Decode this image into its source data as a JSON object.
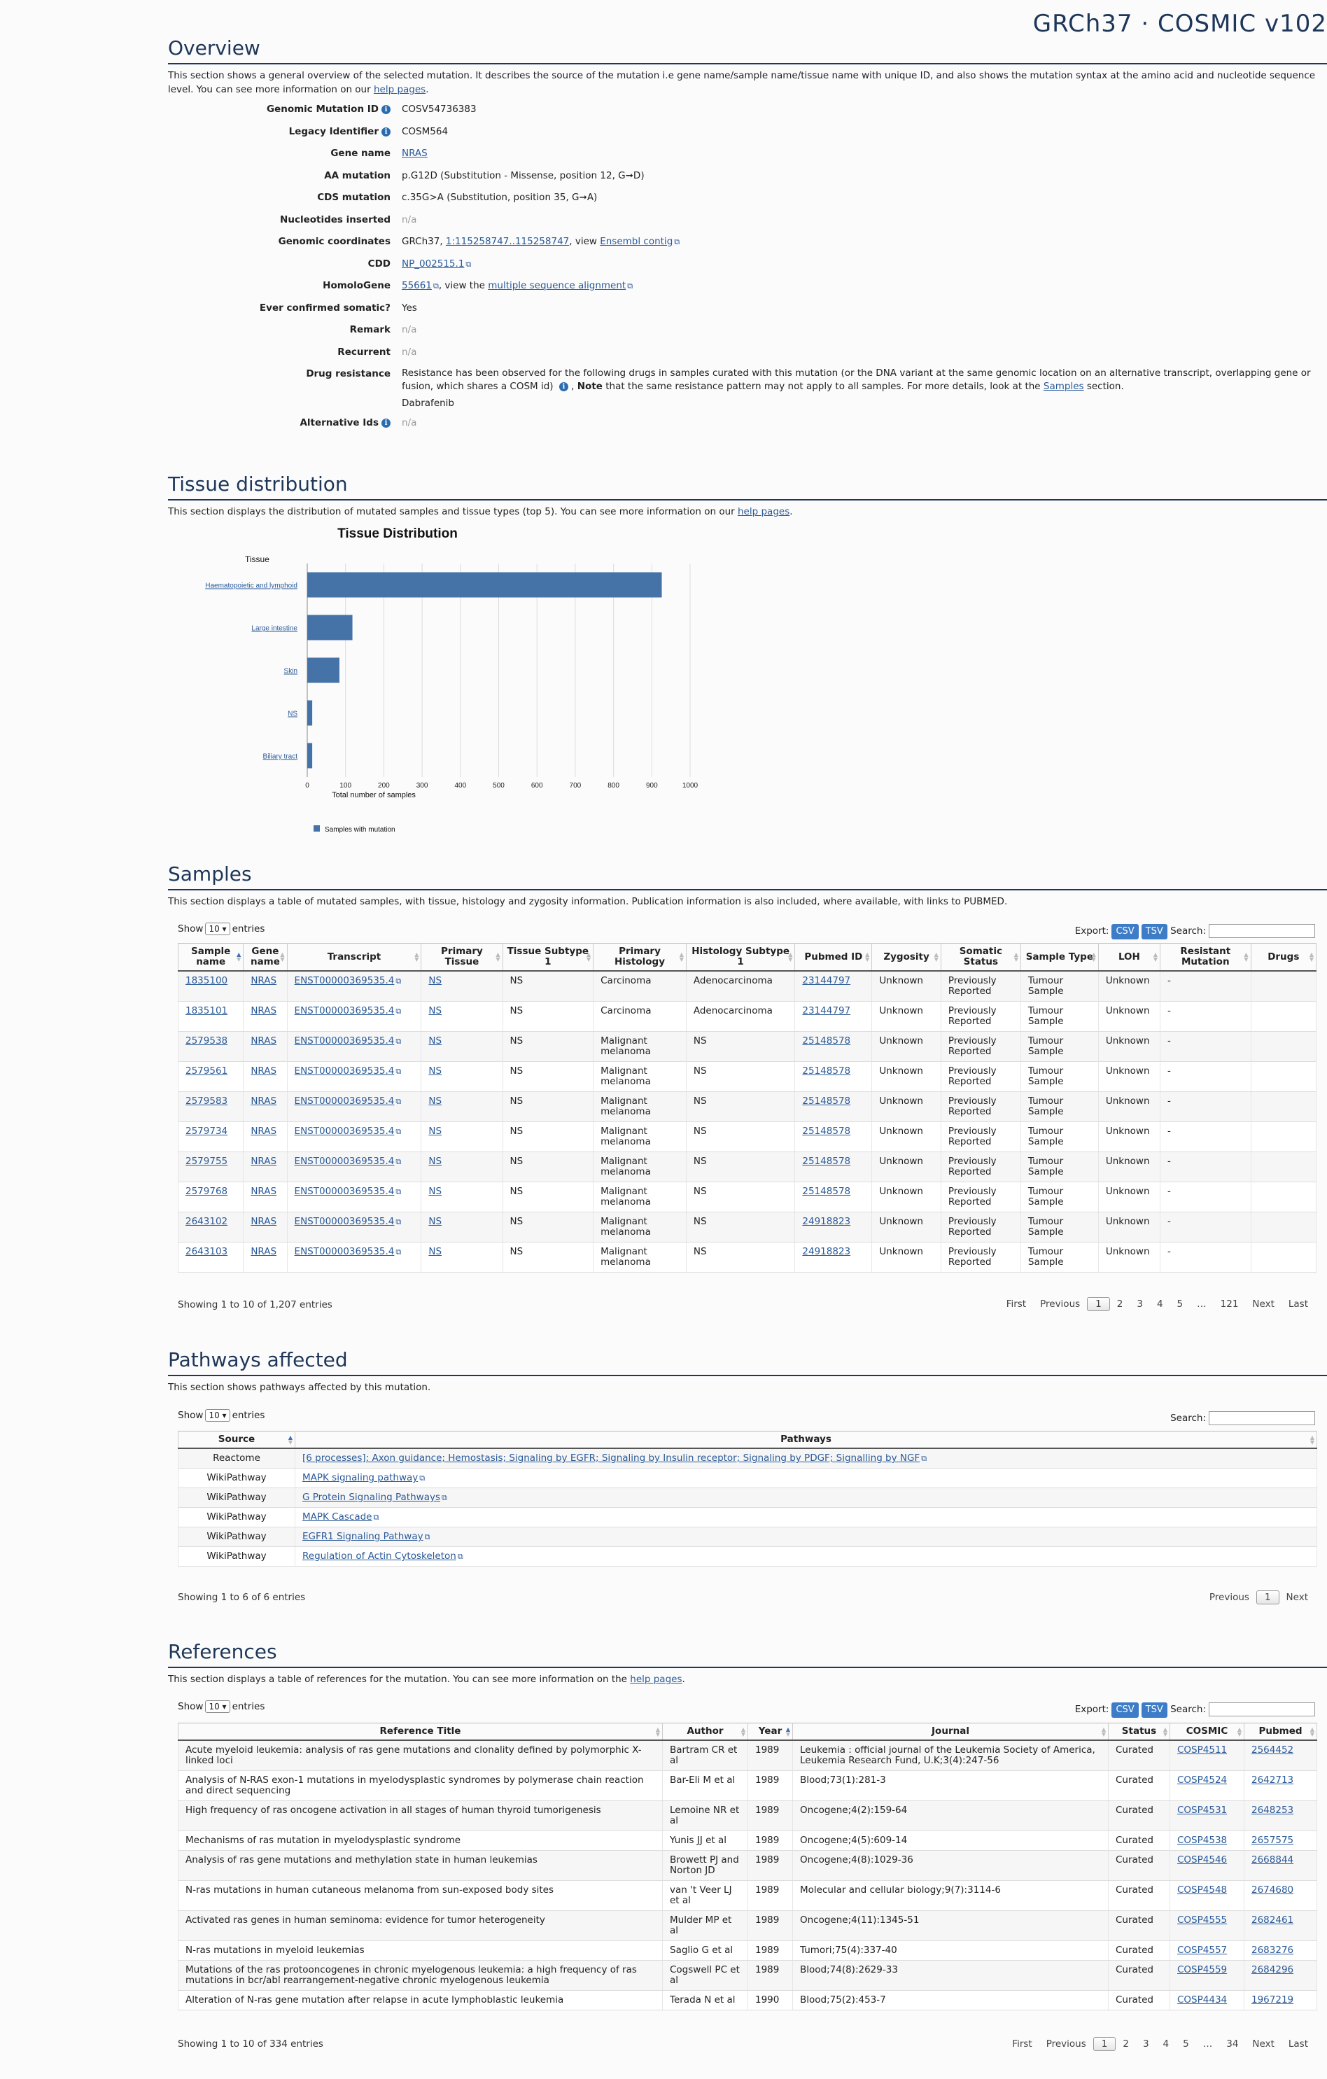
{
  "brand": "GRCh37 · COSMIC v102",
  "overview": {
    "title": "Overview",
    "desc_before": "This section shows a general overview of the selected mutation. It describes the source of the mutation i.e gene name/sample name/tissue name with unique ID, and also shows the mutation syntax at the amino acid and nucleotide sequence level. You can see more information on our ",
    "help_link": "help pages",
    "desc_after": ".",
    "rows": {
      "genomic_mutation_id": {
        "label": "Genomic Mutation ID",
        "value": "COSV54736383"
      },
      "legacy_identifier": {
        "label": "Legacy Identifier",
        "value": "COSM564"
      },
      "gene_name": {
        "label": "Gene name",
        "value": "NRAS"
      },
      "aa_mutation": {
        "label": "AA mutation",
        "value": "p.G12D (Substitution - Missense, position 12, G➞D)"
      },
      "cds_mutation": {
        "label": "CDS mutation",
        "value": "c.35G>A (Substitution, position 35, G➞A)"
      },
      "nucleotides_inserted": {
        "label": "Nucleotides inserted",
        "value": "n/a"
      },
      "genomic_coordinates": {
        "label": "Genomic coordinates",
        "prefix": "GRCh37, ",
        "link": "1:115258747..115258747",
        "mid": ", view ",
        "link2": "Ensembl contig"
      },
      "cdd": {
        "label": "CDD",
        "link": "NP_002515.1"
      },
      "homologene": {
        "label": "HomoloGene",
        "link": "55661",
        "mid": ", view the ",
        "link2": "multiple sequence alignment"
      },
      "ever_confirmed": {
        "label": "Ever confirmed somatic?",
        "value": "Yes"
      },
      "remark": {
        "label": "Remark",
        "value": "n/a"
      },
      "recurrent": {
        "label": "Recurrent",
        "value": "n/a"
      },
      "drug_resistance": {
        "label": "Drug resistance",
        "text1": "Resistance has been observed for the following drugs in samples curated with this mutation (or the DNA variant at the same genomic location on an alternative transcript, overlapping gene or fusion, which shares a COSM id)",
        "note_label": "Note",
        "text2": " that the same resistance pattern may not apply to all samples. For more details, look at the ",
        "samples_link": "Samples",
        "text3": " section.",
        "drug": "Dabrafenib"
      },
      "alternative_ids": {
        "label": "Alternative Ids",
        "value": "n/a"
      }
    }
  },
  "tissue": {
    "title": "Tissue distribution",
    "desc_before": "This section displays the distribution of mutated samples and tissue types (top 5). You can see more information on our ",
    "help_link": "help pages",
    "desc_after": "."
  },
  "chart_data": {
    "type": "bar",
    "orientation": "horizontal",
    "title": "Tissue Distribution",
    "ylabel": "Tissue",
    "xlabel": "Total number of samples",
    "categories": [
      "Haematopoietic and lymphoid",
      "Large intestine",
      "Skin",
      "NS",
      "Biliary tract"
    ],
    "series": [
      {
        "name": "Samples with mutation",
        "values": [
          926,
          118,
          84,
          13,
          13
        ],
        "color": "#4572a7"
      }
    ],
    "xlim": [
      0,
      1000
    ],
    "xticks": [
      0,
      100,
      200,
      300,
      400,
      500,
      600,
      700,
      800,
      900,
      1000
    ],
    "grid": true,
    "legend": "bottom-left"
  },
  "samples": {
    "title": "Samples",
    "desc": "This section displays a table of mutated samples, with tissue, histology and zygosity information. Publication information is also included, where available, with links to PUBMED.",
    "show": "Show",
    "page_size": "10",
    "entries": "entries",
    "export": "Export:",
    "csv": "CSV",
    "tsv": "TSV",
    "search": "Search:",
    "columns": [
      "Sample name",
      "Gene name",
      "Transcript",
      "Primary Tissue",
      "Tissue Subtype 1",
      "Primary Histology",
      "Histology Subtype 1",
      "Pubmed ID",
      "Zygosity",
      "Somatic Status",
      "Sample Type",
      "LOH",
      "Resistant Mutation",
      "Drugs"
    ],
    "rows": [
      [
        "1835100",
        "NRAS",
        "ENST00000369535.4",
        "NS",
        "NS",
        "Carcinoma",
        "Adenocarcinoma",
        "23144797",
        "Unknown",
        "Previously Reported",
        "Tumour Sample",
        "Unknown",
        "-",
        ""
      ],
      [
        "1835101",
        "NRAS",
        "ENST00000369535.4",
        "NS",
        "NS",
        "Carcinoma",
        "Adenocarcinoma",
        "23144797",
        "Unknown",
        "Previously Reported",
        "Tumour Sample",
        "Unknown",
        "-",
        ""
      ],
      [
        "2579538",
        "NRAS",
        "ENST00000369535.4",
        "NS",
        "NS",
        "Malignant melanoma",
        "NS",
        "25148578",
        "Unknown",
        "Previously Reported",
        "Tumour Sample",
        "Unknown",
        "-",
        ""
      ],
      [
        "2579561",
        "NRAS",
        "ENST00000369535.4",
        "NS",
        "NS",
        "Malignant melanoma",
        "NS",
        "25148578",
        "Unknown",
        "Previously Reported",
        "Tumour Sample",
        "Unknown",
        "-",
        ""
      ],
      [
        "2579583",
        "NRAS",
        "ENST00000369535.4",
        "NS",
        "NS",
        "Malignant melanoma",
        "NS",
        "25148578",
        "Unknown",
        "Previously Reported",
        "Tumour Sample",
        "Unknown",
        "-",
        ""
      ],
      [
        "2579734",
        "NRAS",
        "ENST00000369535.4",
        "NS",
        "NS",
        "Malignant melanoma",
        "NS",
        "25148578",
        "Unknown",
        "Previously Reported",
        "Tumour Sample",
        "Unknown",
        "-",
        ""
      ],
      [
        "2579755",
        "NRAS",
        "ENST00000369535.4",
        "NS",
        "NS",
        "Malignant melanoma",
        "NS",
        "25148578",
        "Unknown",
        "Previously Reported",
        "Tumour Sample",
        "Unknown",
        "-",
        ""
      ],
      [
        "2579768",
        "NRAS",
        "ENST00000369535.4",
        "NS",
        "NS",
        "Malignant melanoma",
        "NS",
        "25148578",
        "Unknown",
        "Previously Reported",
        "Tumour Sample",
        "Unknown",
        "-",
        ""
      ],
      [
        "2643102",
        "NRAS",
        "ENST00000369535.4",
        "NS",
        "NS",
        "Malignant melanoma",
        "NS",
        "24918823",
        "Unknown",
        "Previously Reported",
        "Tumour Sample",
        "Unknown",
        "-",
        ""
      ],
      [
        "2643103",
        "NRAS",
        "ENST00000369535.4",
        "NS",
        "NS",
        "Malignant melanoma",
        "NS",
        "24918823",
        "Unknown",
        "Previously Reported",
        "Tumour Sample",
        "Unknown",
        "-",
        ""
      ]
    ],
    "showing": "Showing 1 to 10 of 1,207 entries",
    "pager": [
      "First",
      "Previous",
      "1",
      "2",
      "3",
      "4",
      "5",
      "…",
      "121",
      "Next",
      "Last"
    ]
  },
  "pathways": {
    "title": "Pathways affected",
    "desc": "This section shows pathways affected by this mutation.",
    "show": "Show",
    "page_size": "10",
    "entries": "entries",
    "search": "Search:",
    "columns": [
      "Source",
      "Pathways"
    ],
    "rows": [
      [
        "Reactome",
        "[6 processes]: Axon guidance; Hemostasis; Signaling by EGFR; Signaling by Insulin receptor; Signaling by PDGF; Signalling by NGF"
      ],
      [
        "WikiPathway",
        "MAPK signaling pathway"
      ],
      [
        "WikiPathway",
        "G Protein Signaling Pathways"
      ],
      [
        "WikiPathway",
        "MAPK Cascade"
      ],
      [
        "WikiPathway",
        "EGFR1 Signaling Pathway"
      ],
      [
        "WikiPathway",
        "Regulation of Actin Cytoskeleton"
      ]
    ],
    "showing": "Showing 1 to 6 of 6 entries",
    "pager": [
      "Previous",
      "1",
      "Next"
    ]
  },
  "references": {
    "title": "References",
    "desc_before": "This section displays a table of references for the mutation. You can see more information on the ",
    "help_link": "help pages",
    "desc_after": ".",
    "show": "Show",
    "page_size": "10",
    "entries": "entries",
    "export": "Export:",
    "csv": "CSV",
    "tsv": "TSV",
    "search": "Search:",
    "columns": [
      "Reference Title",
      "Author",
      "Year",
      "Journal",
      "Status",
      "COSMIC",
      "Pubmed"
    ],
    "rows": [
      [
        "Acute myeloid leukemia: analysis of ras gene mutations and clonality defined by polymorphic X-linked loci",
        "Bartram CR et al",
        "1989",
        "Leukemia : official journal of the Leukemia Society of America, Leukemia Research Fund, U.K;3(4):247-56",
        "Curated",
        "COSP4511",
        "2564452"
      ],
      [
        "Analysis of N-RAS exon-1 mutations in myelodysplastic syndromes by polymerase chain reaction and direct sequencing",
        "Bar-Eli M et al",
        "1989",
        "Blood;73(1):281-3",
        "Curated",
        "COSP4524",
        "2642713"
      ],
      [
        "High frequency of ras oncogene activation in all stages of human thyroid tumorigenesis",
        "Lemoine NR et al",
        "1989",
        "Oncogene;4(2):159-64",
        "Curated",
        "COSP4531",
        "2648253"
      ],
      [
        "Mechanisms of ras mutation in myelodysplastic syndrome",
        "Yunis JJ et al",
        "1989",
        "Oncogene;4(5):609-14",
        "Curated",
        "COSP4538",
        "2657575"
      ],
      [
        "Analysis of ras gene mutations and methylation state in human leukemias",
        "Browett PJ and Norton JD",
        "1989",
        "Oncogene;4(8):1029-36",
        "Curated",
        "COSP4546",
        "2668844"
      ],
      [
        "N-ras mutations in human cutaneous melanoma from sun-exposed body sites",
        "van 't Veer LJ et al",
        "1989",
        "Molecular and cellular biology;9(7):3114-6",
        "Curated",
        "COSP4548",
        "2674680"
      ],
      [
        "Activated ras genes in human seminoma: evidence for tumor heterogeneity",
        "Mulder MP et al",
        "1989",
        "Oncogene;4(11):1345-51",
        "Curated",
        "COSP4555",
        "2682461"
      ],
      [
        "N-ras mutations in myeloid leukemias",
        "Saglio G et al",
        "1989",
        "Tumori;75(4):337-40",
        "Curated",
        "COSP4557",
        "2683276"
      ],
      [
        "Mutations of the ras protooncogenes in chronic myelogenous leukemia: a high frequency of ras mutations in bcr/abl rearrangement-negative chronic myelogenous leukemia",
        "Cogswell PC et al",
        "1989",
        "Blood;74(8):2629-33",
        "Curated",
        "COSP4559",
        "2684296"
      ],
      [
        "Alteration of N-ras gene mutation after relapse in acute lymphoblastic leukemia",
        "Terada N et al",
        "1990",
        "Blood;75(2):453-7",
        "Curated",
        "COSP4434",
        "1967219"
      ]
    ],
    "showing": "Showing 1 to 10 of 334 entries",
    "pager": [
      "First",
      "Previous",
      "1",
      "2",
      "3",
      "4",
      "5",
      "…",
      "34",
      "Next",
      "Last"
    ]
  }
}
